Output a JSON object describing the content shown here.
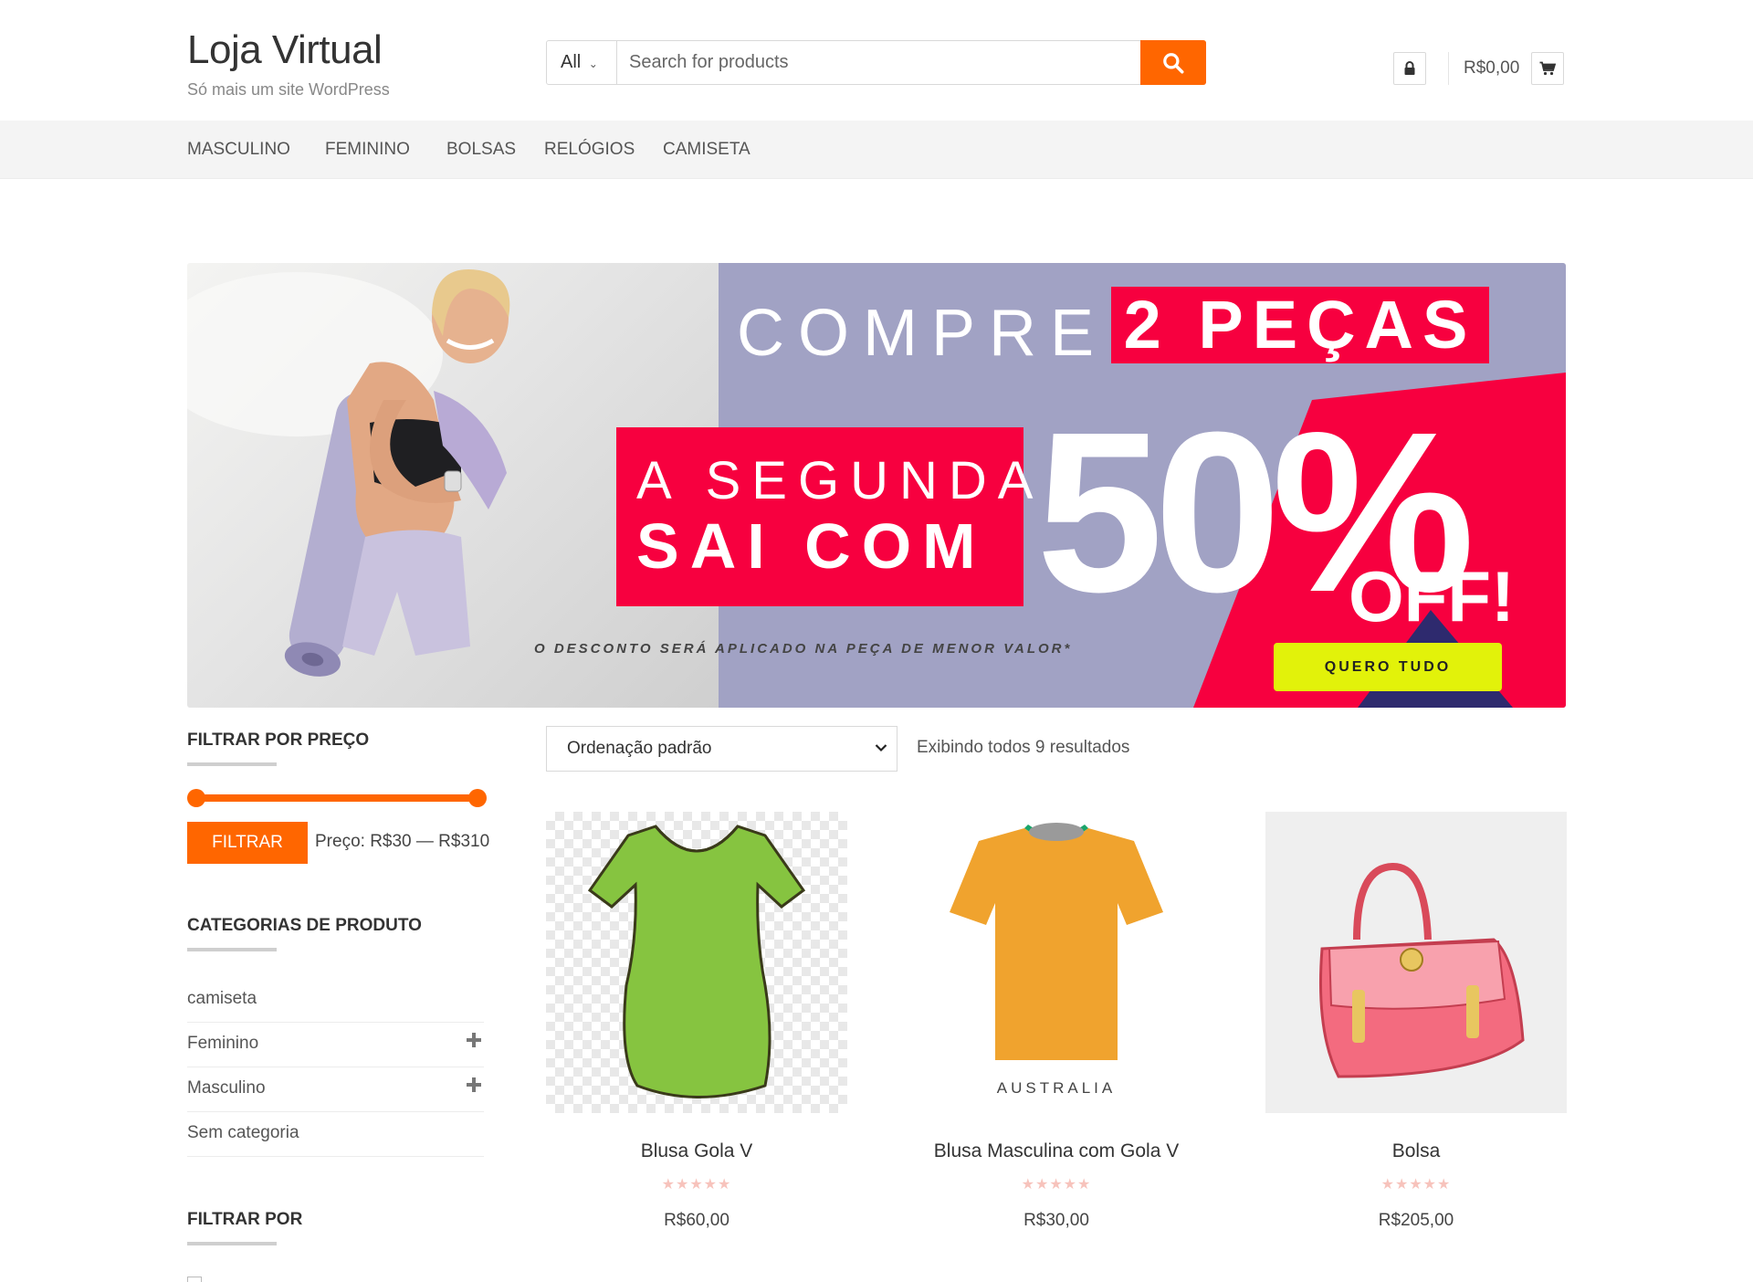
{
  "site": {
    "title": "Loja Virtual",
    "description": "Só mais um site WordPress"
  },
  "search": {
    "category": "All",
    "placeholder": "Search for products"
  },
  "cart": {
    "total": "R$0,00"
  },
  "nav": {
    "items": [
      "MASCULINO",
      "FEMININO",
      "BOLSAS",
      "RELÓGIOS",
      "CAMISETA"
    ]
  },
  "banner": {
    "compre": "COMPRE",
    "pecas": "2 PEÇAS",
    "segunda_line1": "A SEGUNDA",
    "segunda_line2": "SAI COM",
    "discount": "50%",
    "off": "OFF!",
    "note": "O DESCONTO SERÁ APLICADO NA PEÇA DE MENOR VALOR*",
    "cta": "QUERO TUDO"
  },
  "sidebar": {
    "price_filter_title": "FILTRAR POR PREÇO",
    "filter_button": "FILTRAR",
    "price_label": "Preço: R$30 — R$310",
    "categories_title": "CATEGORIAS DE PRODUTO",
    "categories": [
      {
        "label": "camiseta",
        "expandable": false
      },
      {
        "label": "Feminino",
        "expandable": true
      },
      {
        "label": "Masculino",
        "expandable": true
      },
      {
        "label": "Sem categoria",
        "expandable": false
      }
    ],
    "filter_by_title": "FILTRAR POR"
  },
  "main": {
    "orderby": "Ordenação padrão",
    "results": "Exibindo todos 9 resultados",
    "products": [
      {
        "name": "Blusa Gola V",
        "rating": "★★★★★",
        "price": "R$60,00"
      },
      {
        "name": "Blusa Masculina com Gola V",
        "rating": "★★★★★",
        "price": "R$30,00",
        "image_caption": "AUSTRALIA"
      },
      {
        "name": "Bolsa",
        "rating": "★★★★★",
        "price": "R$205,00"
      }
    ]
  },
  "colors": {
    "accent": "#ff6600",
    "banner_red": "#f7003f",
    "banner_lilac": "#a1a2c4",
    "cta_yellow": "#e2f20a"
  }
}
